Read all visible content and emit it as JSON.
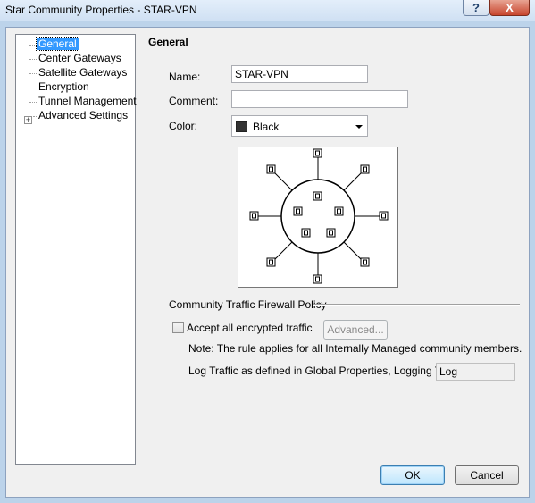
{
  "window": {
    "title": "Star Community Properties - STAR-VPN",
    "help_glyph": "?",
    "close_glyph": "X"
  },
  "tree": {
    "items": [
      {
        "label": "General",
        "selected": true
      },
      {
        "label": "Center Gateways"
      },
      {
        "label": "Satellite Gateways"
      },
      {
        "label": "Encryption"
      },
      {
        "label": "Tunnel Management"
      },
      {
        "label": "Advanced Settings",
        "expandable": true
      }
    ],
    "expander_glyph": "+"
  },
  "general": {
    "heading": "General",
    "name_label": "Name:",
    "name_value": "STAR-VPN",
    "comment_label": "Comment:",
    "comment_value": "",
    "color_label": "Color:",
    "color_value": "Black",
    "color_swatch": "#333333"
  },
  "policy": {
    "group_title": "Community Traffic Firewall Policy",
    "accept_label": "Accept all encrypted traffic",
    "accept_checked": false,
    "advanced_button": "Advanced...",
    "note": "Note: The rule applies for all Internally Managed community members.",
    "log_label": "Log Traffic as defined in Global Properties, Logging Tab:",
    "log_value": "Log"
  },
  "footer": {
    "ok_button": "OK",
    "cancel_button": "Cancel"
  }
}
